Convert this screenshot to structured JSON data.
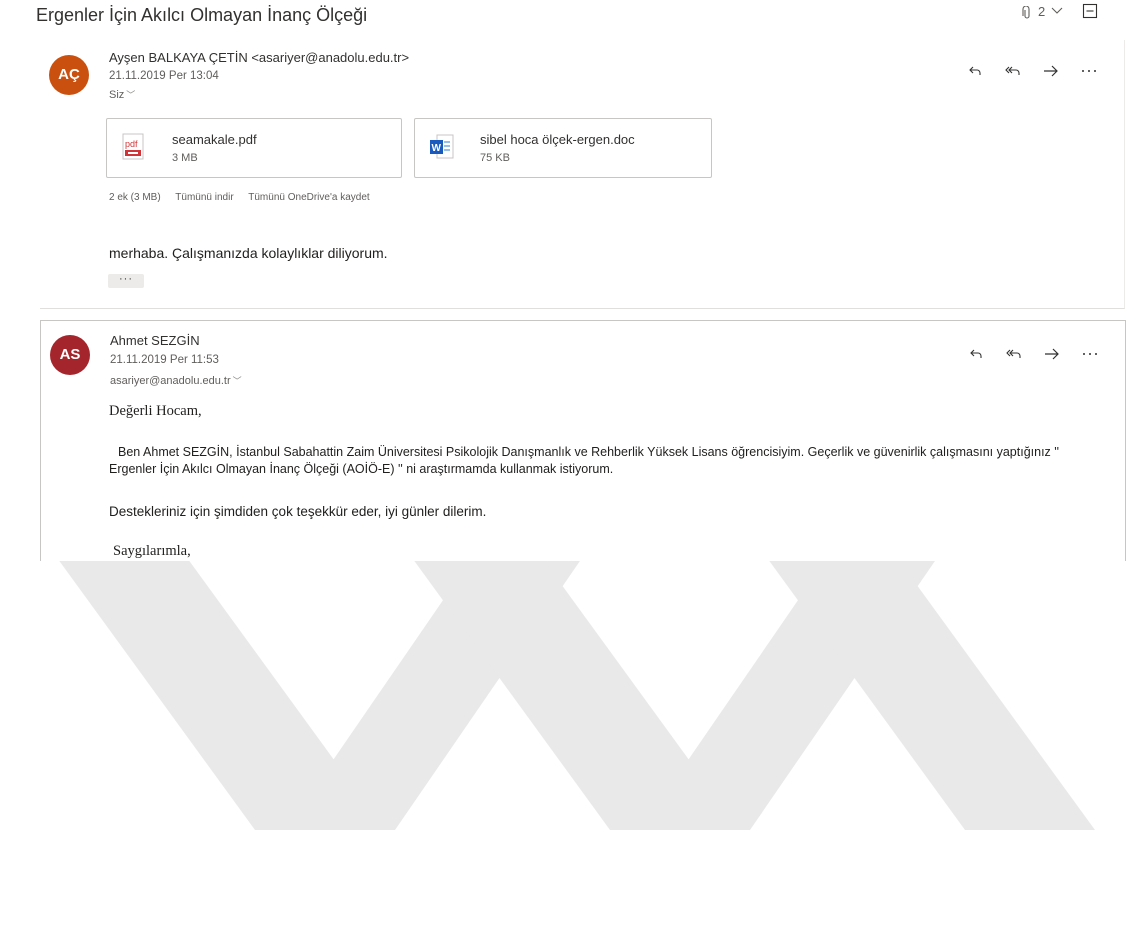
{
  "thread": {
    "subject": "Ergenler İçin Akılcı Olmayan İnanç Ölçeği",
    "attachment_count": "2"
  },
  "message1": {
    "initials": "AÇ",
    "avatar_color": "#ca5010",
    "sender": "Ayşen BALKAYA ÇETİN <asariyer@anadolu.edu.tr>",
    "date": "21.11.2019 Per 13:04",
    "recipient": "Siz",
    "attachments": [
      {
        "name": "seamakale.pdf",
        "size": "3 MB",
        "icon": "pdf-file-icon"
      },
      {
        "name": "sibel hoca ölçek-ergen.doc",
        "size": "75 KB",
        "icon": "word-file-icon"
      }
    ],
    "summary": {
      "count": "2 ek (3 MB)",
      "download_all": "Tümünü indir",
      "save_onedrive": "Tümünü OneDrive'a kaydet"
    },
    "body": "merhaba. Çalışmanızda kolaylıklar diliyorum.",
    "ellipsis": "···"
  },
  "message2": {
    "initials": "AS",
    "avatar_color": "#a4262c",
    "sender": "Ahmet SEZGİN",
    "date": "21.11.2019 Per 11:53",
    "recipient": "asariyer@anadolu.edu.tr",
    "greeting": "Değerli Hocam,",
    "paragraph": "Ben Ahmet SEZGİN, İstanbul Sabahattin Zaim Üniversitesi Psikolojik Danışmanlık ve Rehberlik Yüksek Lisans öğrencisiyim. Geçerlik ve güvenirlik çalışmasını yaptığınız '' Ergenler İçin Akılcı Olmayan İnanç Ölçeği (AOİÖ-E) '' ni araştırmamda kullanmak istiyorum.",
    "thanks": "Destekleriniz için şimdiden çok teşekkür eder, iyi günler dilerim.",
    "signoff": "Saygılarımla,"
  },
  "icons": {
    "actions": [
      "reply-icon",
      "reply-all-icon",
      "forward-icon",
      "more-icon"
    ],
    "accent_color": "#0078d4"
  }
}
